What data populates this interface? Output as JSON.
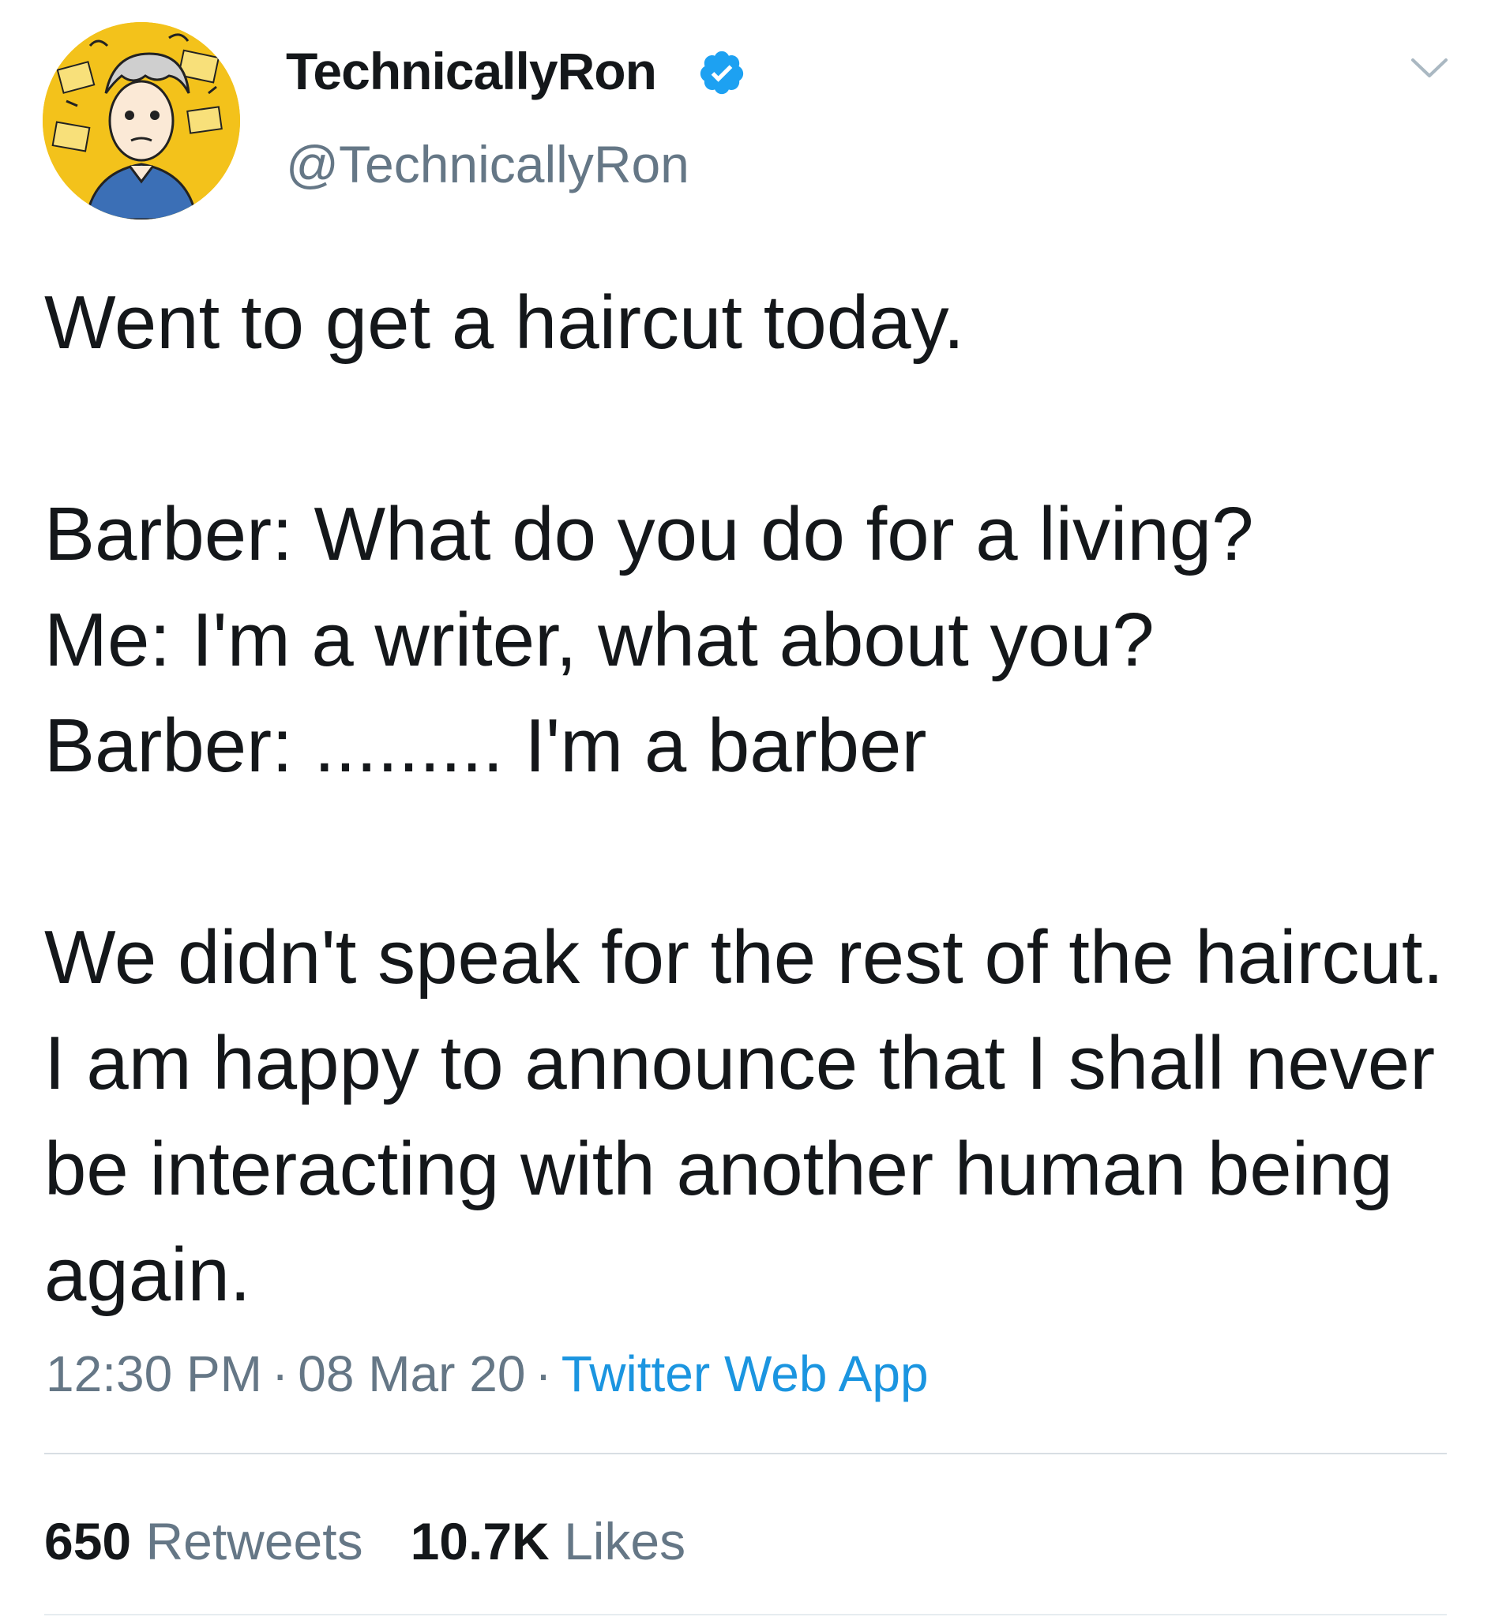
{
  "author": {
    "display_name": "TechnicallyRon",
    "handle": "@TechnicallyRon",
    "verified": true,
    "avatar_icon": "illustrated-avatar-icon",
    "avatar_bg": "#f3c21b"
  },
  "tweet": {
    "text": "Went to get a haircut today.\n\nBarber: What do you do for a living?\nMe: I'm a writer, what about you?\nBarber: ......... I'm a barber\n\nWe didn't speak for the rest of the haircut. I am happy to announce that I shall never be interacting with another human being again."
  },
  "meta": {
    "time": "12:30 PM",
    "separator": "·",
    "date": "08 Mar 20",
    "source": "Twitter Web App"
  },
  "stats": {
    "retweets_count": "650",
    "retweets_label": "Retweets",
    "likes_count": "10.7K",
    "likes_label": "Likes"
  },
  "colors": {
    "text": "#14171a",
    "secondary": "#657786",
    "link": "#1b95e0",
    "verified": "#1da1f2"
  }
}
